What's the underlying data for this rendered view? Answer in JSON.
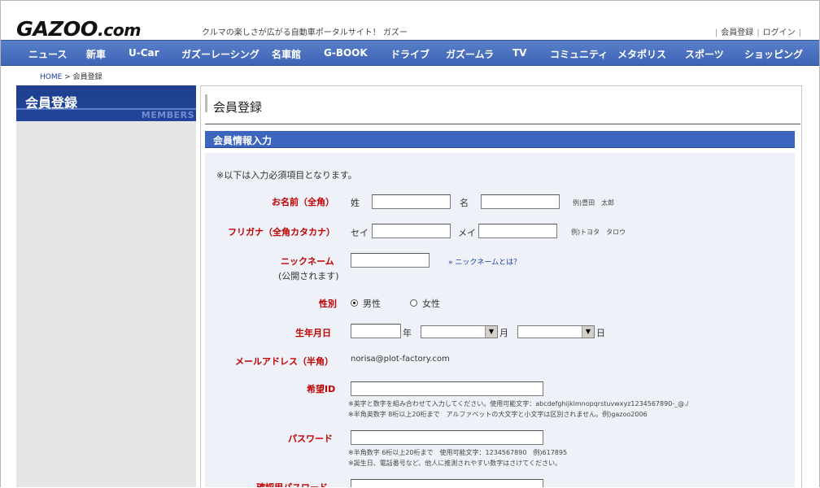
{
  "header": {
    "logo": "GAZOO",
    "logo_suffix": ".com",
    "tagline": "クルマの楽しさが広がる自動車ポータルサイト！ ガズー",
    "util_register": "会員登録",
    "util_login": "ログイン"
  },
  "nav": {
    "items": [
      "ニュース",
      "新車",
      "U-Car",
      "ガズーレーシング",
      "名車館",
      "G-BOOK",
      "ドライブ",
      "ガズームラ",
      "TV",
      "コミュニティ",
      "メタポリス",
      "スポーツ",
      "ショッピング"
    ]
  },
  "breadcrumb": {
    "home": "HOME",
    "sep": " > ",
    "current": "会員登録"
  },
  "sidebar": {
    "title": "会員登録",
    "subtitle": "MEMBERS"
  },
  "main": {
    "title": "会員登録",
    "section_title": "会員情報入力",
    "note": "※以下は入力必須項目となります。"
  },
  "form": {
    "name": {
      "label": "お名前（全角）",
      "last_label": "姓",
      "first_label": "名",
      "example": "例)豊田　太郎"
    },
    "kana": {
      "label": "フリガナ（全角カタカナ）",
      "last_label": "セイ",
      "first_label": "メイ",
      "example": "例)トヨタ　タロウ"
    },
    "nickname": {
      "label": "ニックネーム",
      "sublabel": "(公開されます)",
      "link": "» ニックネームとは？"
    },
    "gender": {
      "label": "性別",
      "options": [
        "男性",
        "女性"
      ],
      "selected": "男性"
    },
    "birth": {
      "label": "生年月日",
      "year_unit": "年",
      "month_unit": "月",
      "day_unit": "日"
    },
    "email": {
      "label": "メールアドレス（半角）",
      "value": "norisa@plot-factory.com"
    },
    "user_id": {
      "label": "希望ID",
      "hint1": "※英字と数字を組み合わせて入力してください。使用可能文字：abcdefghijklmnopqrstuvwxyz1234567890-_@./",
      "hint2": "※半角英数字 8桁以上20桁まで　アルファベットの大文字と小文字は区別されません。例)gazoo2006"
    },
    "password": {
      "label": "パスワード",
      "hint1": "※半角数字 6桁以上20桁まで　使用可能文字：1234567890　例)617895",
      "hint2": "※誕生日、電話番号など、他人に推測されやすい数字はさけてください。"
    },
    "password_confirm": {
      "label": "確認用パスワード"
    }
  }
}
